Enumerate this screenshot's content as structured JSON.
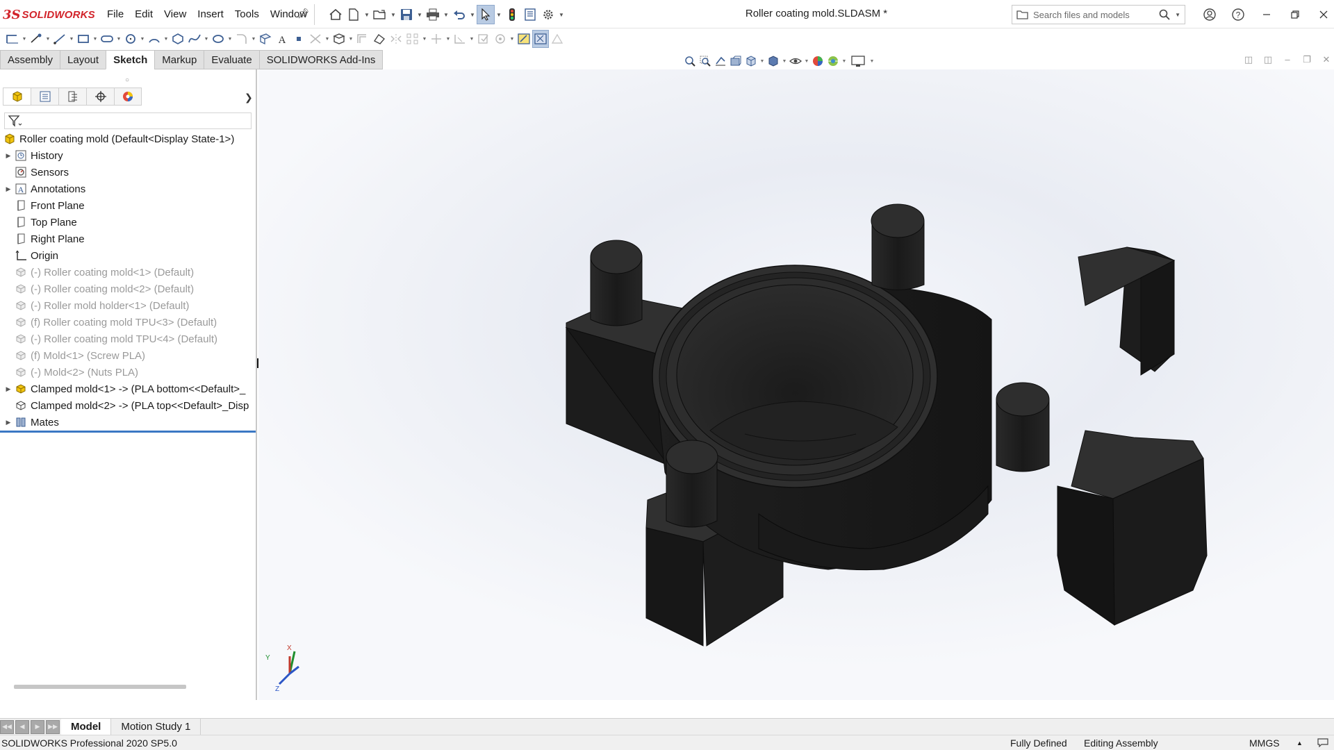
{
  "app": {
    "brand_prefix": "3S",
    "brand": "SOLIDWORKS",
    "document_title": "Roller coating mold.SLDASM *",
    "accent": "#d2232a"
  },
  "menu": [
    "File",
    "Edit",
    "View",
    "Insert",
    "Tools",
    "Window"
  ],
  "search": {
    "placeholder": "Search files and models"
  },
  "ribbon_tabs": [
    {
      "label": "Assembly",
      "active": false
    },
    {
      "label": "Layout",
      "active": false
    },
    {
      "label": "Sketch",
      "active": true
    },
    {
      "label": "Markup",
      "active": false
    },
    {
      "label": "Evaluate",
      "active": false
    },
    {
      "label": "SOLIDWORKS Add-Ins",
      "active": false
    }
  ],
  "tree": {
    "root": "Roller coating mold  (Default<Display State-1>)",
    "items": [
      {
        "label": "History",
        "icon": "history-icon",
        "expandable": true,
        "muted": false
      },
      {
        "label": "Sensors",
        "icon": "sensors-icon",
        "expandable": false,
        "muted": false
      },
      {
        "label": "Annotations",
        "icon": "annotations-icon",
        "expandable": true,
        "muted": false
      },
      {
        "label": "Front Plane",
        "icon": "plane-icon",
        "expandable": false,
        "muted": false
      },
      {
        "label": "Top Plane",
        "icon": "plane-icon",
        "expandable": false,
        "muted": false
      },
      {
        "label": "Right Plane",
        "icon": "plane-icon",
        "expandable": false,
        "muted": false
      },
      {
        "label": "Origin",
        "icon": "origin-icon",
        "expandable": false,
        "muted": false
      },
      {
        "label": "(-) Roller coating mold<1> (Default)",
        "icon": "part-icon",
        "expandable": false,
        "muted": true
      },
      {
        "label": "(-) Roller coating mold<2> (Default)",
        "icon": "part-icon",
        "expandable": false,
        "muted": true
      },
      {
        "label": "(-) Roller mold holder<1> (Default)",
        "icon": "part-icon",
        "expandable": false,
        "muted": true
      },
      {
        "label": "(f) Roller coating mold TPU<3> (Default)",
        "icon": "part-icon",
        "expandable": false,
        "muted": true
      },
      {
        "label": "(-) Roller coating mold TPU<4> (Default)",
        "icon": "part-icon",
        "expandable": false,
        "muted": true
      },
      {
        "label": "(f) Mold<1> (Screw PLA)",
        "icon": "part-icon",
        "expandable": false,
        "muted": true
      },
      {
        "label": "(-) Mold<2> (Nuts PLA)",
        "icon": "part-icon",
        "expandable": false,
        "muted": true
      },
      {
        "label": "Clamped mold<1> -> (PLA bottom<<Default>_",
        "icon": "subassembly-icon",
        "expandable": true,
        "muted": false
      },
      {
        "label": "Clamped mold<2> -> (PLA top<<Default>_Disp",
        "icon": "part-icon",
        "expandable": false,
        "muted": false
      },
      {
        "label": "Mates",
        "icon": "mates-icon",
        "expandable": true,
        "muted": false
      }
    ]
  },
  "bottom_tabs": [
    {
      "label": "Model",
      "active": true
    },
    {
      "label": "Motion Study 1",
      "active": false
    }
  ],
  "status": {
    "product": "SOLIDWORKS Professional 2020 SP5.0",
    "sketch_state": "Fully Defined",
    "mode": "Editing Assembly",
    "units": "MMGS"
  },
  "triad": {
    "x": "X",
    "y": "Y",
    "z": "Z"
  }
}
